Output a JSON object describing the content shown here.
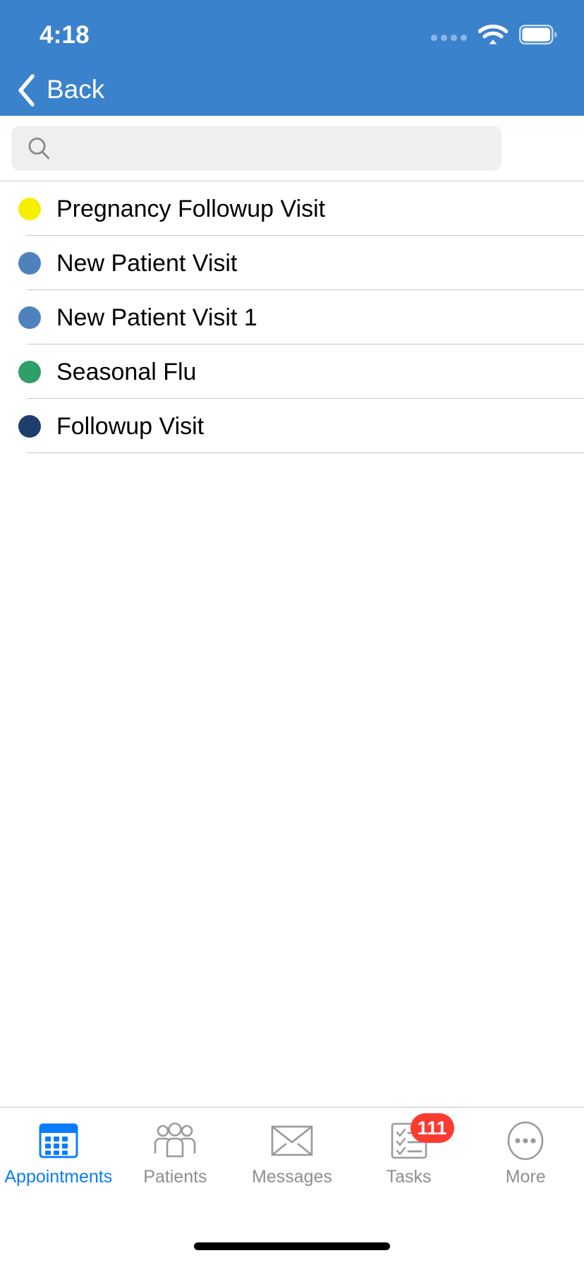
{
  "status_bar": {
    "time": "4:18",
    "signal_icon": "signal-dots-icon",
    "wifi_icon": "wifi-icon",
    "battery_icon": "battery-full-icon"
  },
  "nav_bar": {
    "back_label": "Back",
    "back_icon": "chevron-left-icon",
    "background_color": "#3b82cd"
  },
  "search": {
    "value": "",
    "placeholder": "",
    "icon": "search-icon"
  },
  "list": {
    "items": [
      {
        "label": "Pregnancy Followup Visit",
        "color": "#f7ef00"
      },
      {
        "label": "New Patient Visit",
        "color": "#4f82bd"
      },
      {
        "label": "New Patient Visit 1",
        "color": "#4f82bd"
      },
      {
        "label": "Seasonal Flu",
        "color": "#2f9e68"
      },
      {
        "label": "Followup Visit",
        "color": "#1d3f70"
      }
    ]
  },
  "tab_bar": {
    "active_color": "#0a7cff",
    "inactive_color": "#8e8e93",
    "tabs": [
      {
        "label": "Appointments",
        "icon": "calendar-icon",
        "active": true,
        "badge": ""
      },
      {
        "label": "Patients",
        "icon": "people-icon",
        "active": false,
        "badge": ""
      },
      {
        "label": "Messages",
        "icon": "envelope-icon",
        "active": false,
        "badge": ""
      },
      {
        "label": "Tasks",
        "icon": "checklist-icon",
        "active": false,
        "badge": "111"
      },
      {
        "label": "More",
        "icon": "ellipsis-circle-icon",
        "active": false,
        "badge": ""
      }
    ]
  }
}
